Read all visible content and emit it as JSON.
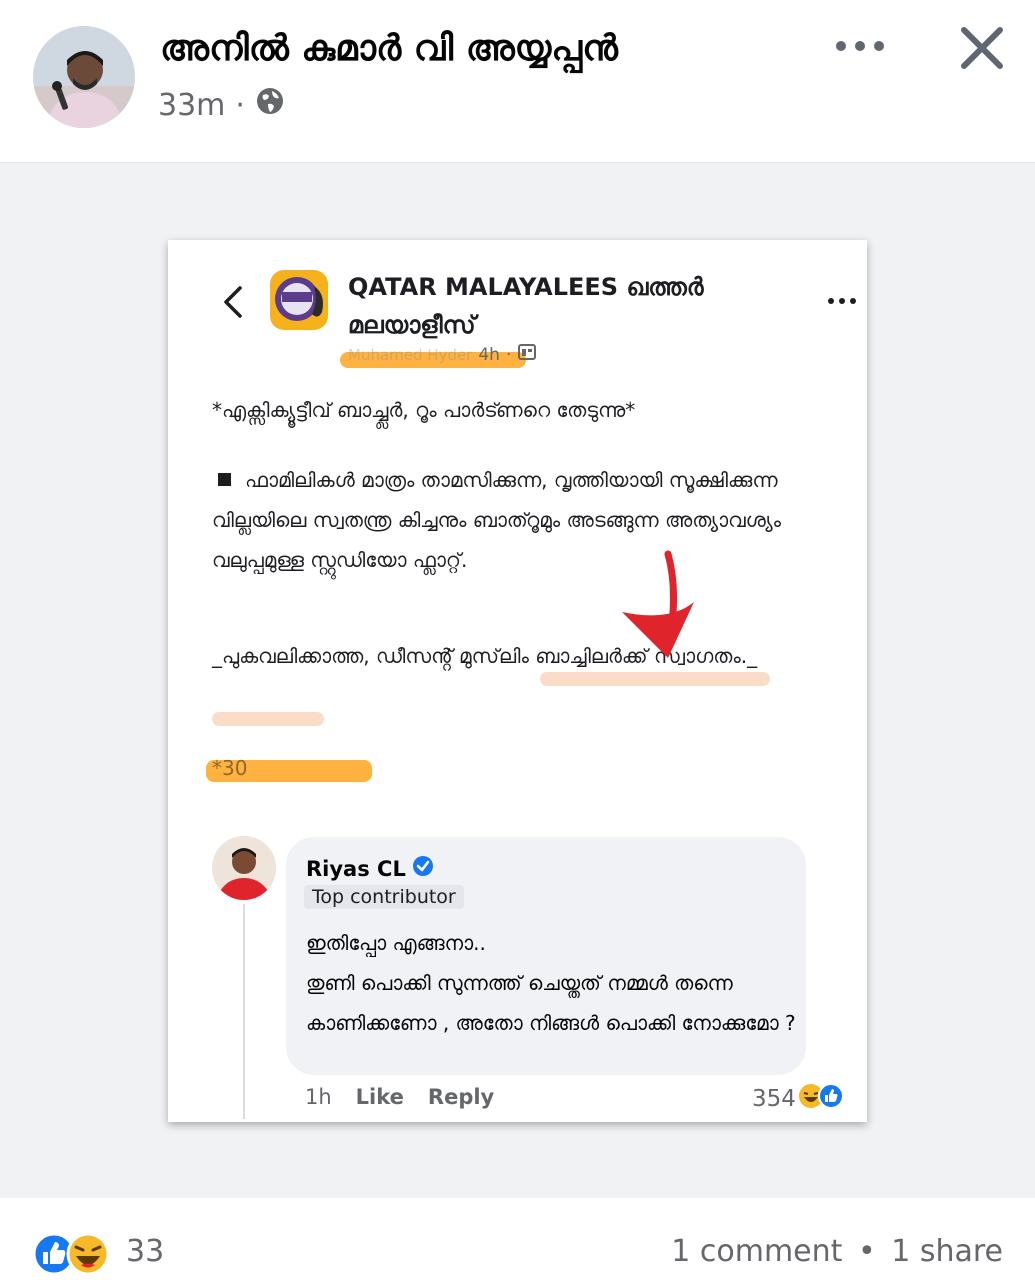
{
  "post": {
    "author": "അനിൽ കുമാർ വി അയ്യപ്പൻ",
    "time": "33m",
    "separator": "·",
    "privacy_icon": "globe-icon"
  },
  "screenshot": {
    "group_name": "QATAR MALAYALEES ഖത്തർ മലയാളീസ്",
    "poster_name_redacted": "Muhamed Hyder",
    "post_time": "4h",
    "sub_separator": "·",
    "text_line1": "*എക്സിക്യൂട്ടീവ് ബാച്ച്ലർ, റൂം പാർട്ണറെ തേടുന്നു*",
    "text_para2": "ഫാമിലികൾ മാത്രം താമസിക്കുന്ന, വൃത്തിയായി സൂക്ഷിക്കുന്ന വില്ലയിലെ സ്വതന്ത്ര കിച്ചനും ബാത്റൂമും അടങ്ങുന്ന അത്യാവശ്യം വലുപ്പമുള്ള സ്റ്റുഡിയോ ഫ്ലാറ്റ്.",
    "text_para3": "_പുകവലിക്കാത്ത, ഡീസൻ്റ് മുസ്‌ലിം ബാച്ചിലർക്ക് സ്വാഗതം._",
    "text_redacted": "*30",
    "comment": {
      "name": "Riyas CL",
      "badge": "Top contributor",
      "line1": "ഇതിപ്പോ  എങ്ങനാ..",
      "line2": "തുണി പൊക്കി സുന്നത്ത് ചെയ്തത്  നമ്മൾ തന്നെ കാണിക്കണോ , അതോ നിങ്ങൾ പൊക്കി നോക്കുമോ ?",
      "time": "1h",
      "like": "Like",
      "reply": "Reply",
      "reaction_count": "354"
    }
  },
  "footer": {
    "reaction_count": "33",
    "comments": "1 comment",
    "bullet": "•",
    "shares": "1 share"
  },
  "colors": {
    "like_blue": "#1877f2",
    "haha_yellow": "#f7b928",
    "highlight_orange": "#ffa41e",
    "highlight_peach": "#f9d3bc",
    "arrow_red": "#e0242b"
  }
}
